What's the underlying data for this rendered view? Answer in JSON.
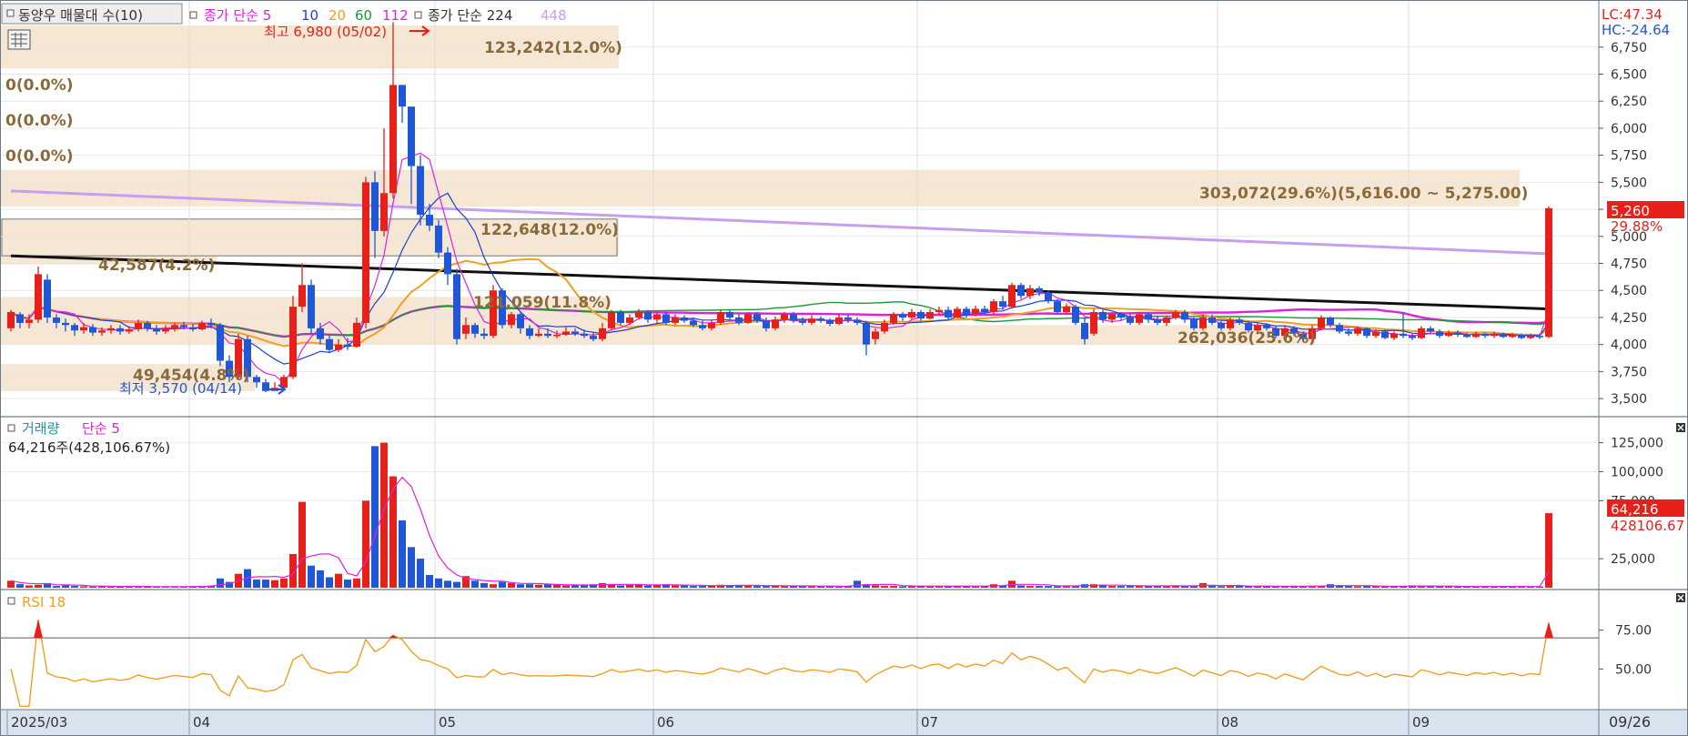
{
  "legend": {
    "profile_label": "동양우 매물대 수(10)",
    "ma_label": "종가 단순 5",
    "ma_periods": [
      {
        "label": "10",
        "color": "#1f3fd0"
      },
      {
        "label": "20",
        "color": "#f0a020"
      },
      {
        "label": "60",
        "color": "#1a9a3a"
      },
      {
        "label": "112",
        "color": "#e020e0"
      }
    ],
    "long_ma_label": "종가 단순 224",
    "long_ma_period": "448"
  },
  "price_panel": {
    "y_ticks": [
      "6,750",
      "6,500",
      "6,250",
      "6,000",
      "5,750",
      "5,500",
      "5,250",
      "5,000",
      "4,750",
      "4,500",
      "4,250",
      "4,000",
      "3,750",
      "3,500"
    ],
    "lc_label": "LC:47.34",
    "hc_label": "HC:-24.64",
    "last_price": "5,260",
    "last_change": "29.88%",
    "high_marker": "최고 6,980 (05/02)",
    "low_marker": "최저 3,570 (04/14)",
    "profile_labels": [
      "0(0.0%)",
      "0(0.0%)",
      "0(0.0%)",
      "123,242(12.0%)",
      "303,072(29.6%)(5,616.00 ~ 5,275.00)",
      "122,648(12.0%)",
      "42,587(4.2%)",
      "121,059(11.8%)",
      "262,036(25.6%)",
      "49,454(4.8%)"
    ]
  },
  "volume_panel": {
    "title": "거래량",
    "ma_label": "단순 5",
    "info": "64,216주(428,106.67%)",
    "y_ticks": [
      "125,000",
      "100,000",
      "75,000",
      "25,000"
    ],
    "last_volume": "64,216",
    "last_ma": "428106.67"
  },
  "rsi_panel": {
    "title": "RSI 18",
    "y_ticks": [
      "75.00",
      "50.00"
    ]
  },
  "x_axis": {
    "labels": [
      "2025/03",
      "04",
      "05",
      "06",
      "07",
      "08",
      "09"
    ],
    "last_date": "09/26"
  },
  "colors": {
    "up": "#e8201a",
    "down": "#1f57d6",
    "rsi": "#f0a020",
    "zone": "#f5e7d3"
  },
  "chart_data": {
    "type": "candlestick",
    "price_range": [
      3400,
      6950
    ],
    "volume_range": [
      0,
      138000
    ],
    "rsi_range": [
      25,
      100
    ],
    "months": [
      "2025/03",
      "04",
      "05",
      "06",
      "07",
      "08",
      "09"
    ],
    "candles": [
      [
        4150,
        4300,
        4320,
        4120
      ],
      [
        4280,
        4200,
        4300,
        4150
      ],
      [
        4200,
        4230,
        4280,
        4150
      ],
      [
        4230,
        4650,
        4720,
        4200
      ],
      [
        4600,
        4250,
        4650,
        4200
      ],
      [
        4250,
        4200,
        4280,
        4150
      ],
      [
        4200,
        4180,
        4240,
        4120
      ],
      [
        4180,
        4130,
        4200,
        4080
      ],
      [
        4130,
        4160,
        4200,
        4100
      ],
      [
        4160,
        4110,
        4190,
        4080
      ],
      [
        4110,
        4130,
        4160,
        4080
      ],
      [
        4130,
        4150,
        4180,
        4100
      ],
      [
        4150,
        4120,
        4180,
        4090
      ],
      [
        4120,
        4140,
        4170,
        4100
      ],
      [
        4140,
        4200,
        4230,
        4120
      ],
      [
        4200,
        4150,
        4220,
        4120
      ],
      [
        4150,
        4120,
        4180,
        4090
      ],
      [
        4120,
        4150,
        4180,
        4100
      ],
      [
        4150,
        4180,
        4200,
        4120
      ],
      [
        4180,
        4160,
        4210,
        4140
      ],
      [
        4160,
        4140,
        4190,
        4120
      ],
      [
        4140,
        4200,
        4220,
        4130
      ],
      [
        4200,
        4180,
        4240,
        4150
      ],
      [
        4180,
        3850,
        4200,
        3800
      ],
      [
        3850,
        3700,
        3900,
        3650
      ],
      [
        3700,
        4050,
        4100,
        3680
      ],
      [
        4050,
        3700,
        4080,
        3650
      ],
      [
        3700,
        3650,
        3720,
        3600
      ],
      [
        3650,
        3570,
        3680,
        3560
      ],
      [
        3570,
        3600,
        3650,
        3570
      ],
      [
        3600,
        3700,
        3720,
        3580
      ],
      [
        3700,
        4350,
        4450,
        3680
      ],
      [
        4350,
        4550,
        4750,
        4300
      ],
      [
        4550,
        4150,
        4600,
        4100
      ],
      [
        4150,
        4050,
        4200,
        4000
      ],
      [
        4050,
        3950,
        4100,
        3920
      ],
      [
        3950,
        4000,
        4050,
        3930
      ],
      [
        4000,
        3980,
        4060,
        3950
      ],
      [
        3980,
        4200,
        4250,
        3970
      ],
      [
        4200,
        5500,
        5550,
        4150
      ],
      [
        5500,
        5050,
        5600,
        4800
      ],
      [
        5050,
        5400,
        6000,
        5000
      ],
      [
        5400,
        6400,
        6980,
        5350
      ],
      [
        6400,
        6200,
        6400,
        6050
      ],
      [
        6200,
        5650,
        6200,
        5300
      ],
      [
        5650,
        5200,
        5750,
        5100
      ],
      [
        5200,
        5100,
        5300,
        5050
      ],
      [
        5100,
        4850,
        5150,
        4800
      ],
      [
        4850,
        4650,
        4900,
        4550
      ],
      [
        4650,
        4050,
        4700,
        4000
      ],
      [
        4100,
        4180,
        4250,
        4050
      ],
      [
        4180,
        4100,
        4200,
        4060
      ],
      [
        4100,
        4080,
        4150,
        4050
      ],
      [
        4080,
        4500,
        4550,
        4060
      ],
      [
        4500,
        4180,
        4520,
        4150
      ],
      [
        4180,
        4280,
        4300,
        4150
      ],
      [
        4280,
        4150,
        4300,
        4100
      ],
      [
        4150,
        4080,
        4180,
        4050
      ],
      [
        4080,
        4100,
        4150,
        4070
      ],
      [
        4100,
        4080,
        4150,
        4060
      ],
      [
        4080,
        4090,
        4130,
        4060
      ],
      [
        4090,
        4120,
        4160,
        4080
      ],
      [
        4120,
        4100,
        4150,
        4080
      ],
      [
        4100,
        4080,
        4140,
        4060
      ],
      [
        4080,
        4050,
        4110,
        4030
      ],
      [
        4050,
        4150,
        4200,
        4030
      ],
      [
        4150,
        4300,
        4320,
        4140
      ],
      [
        4300,
        4200,
        4320,
        4180
      ],
      [
        4200,
        4250,
        4280,
        4180
      ],
      [
        4250,
        4300,
        4330,
        4230
      ],
      [
        4300,
        4230,
        4320,
        4200
      ],
      [
        4230,
        4280,
        4300,
        4200
      ],
      [
        4280,
        4200,
        4300,
        4180
      ],
      [
        4200,
        4250,
        4280,
        4180
      ],
      [
        4250,
        4220,
        4270,
        4200
      ],
      [
        4220,
        4180,
        4250,
        4160
      ],
      [
        4180,
        4150,
        4220,
        4130
      ],
      [
        4150,
        4200,
        4230,
        4130
      ],
      [
        4200,
        4300,
        4320,
        4180
      ],
      [
        4300,
        4250,
        4320,
        4220
      ],
      [
        4250,
        4200,
        4280,
        4180
      ],
      [
        4200,
        4280,
        4300,
        4190
      ],
      [
        4280,
        4220,
        4300,
        4200
      ],
      [
        4220,
        4150,
        4250,
        4120
      ],
      [
        4150,
        4230,
        4260,
        4130
      ],
      [
        4230,
        4280,
        4300,
        4200
      ],
      [
        4280,
        4220,
        4300,
        4200
      ],
      [
        4220,
        4200,
        4250,
        4180
      ],
      [
        4200,
        4240,
        4270,
        4180
      ],
      [
        4240,
        4220,
        4260,
        4200
      ],
      [
        4220,
        4190,
        4240,
        4170
      ],
      [
        4190,
        4250,
        4280,
        4180
      ],
      [
        4250,
        4230,
        4280,
        4200
      ],
      [
        4230,
        4200,
        4250,
        4180
      ],
      [
        4200,
        4000,
        4220,
        3900
      ],
      [
        4050,
        4120,
        4150,
        4000
      ],
      [
        4120,
        4200,
        4230,
        4100
      ],
      [
        4200,
        4280,
        4300,
        4180
      ],
      [
        4280,
        4250,
        4300,
        4220
      ],
      [
        4250,
        4300,
        4330,
        4230
      ],
      [
        4300,
        4240,
        4320,
        4220
      ],
      [
        4240,
        4300,
        4330,
        4230
      ],
      [
        4300,
        4320,
        4350,
        4270
      ],
      [
        4320,
        4250,
        4350,
        4230
      ],
      [
        4250,
        4330,
        4350,
        4240
      ],
      [
        4330,
        4280,
        4350,
        4250
      ],
      [
        4280,
        4330,
        4360,
        4260
      ],
      [
        4330,
        4300,
        4360,
        4280
      ],
      [
        4300,
        4400,
        4420,
        4280
      ],
      [
        4400,
        4350,
        4450,
        4320
      ],
      [
        4350,
        4550,
        4570,
        4330
      ],
      [
        4550,
        4450,
        4570,
        4420
      ],
      [
        4450,
        4520,
        4550,
        4420
      ],
      [
        4520,
        4480,
        4540,
        4450
      ],
      [
        4480,
        4400,
        4500,
        4380
      ],
      [
        4400,
        4300,
        4420,
        4280
      ],
      [
        4300,
        4350,
        4380,
        4280
      ],
      [
        4350,
        4200,
        4370,
        4180
      ],
      [
        4200,
        4050,
        4250,
        4000
      ],
      [
        4100,
        4300,
        4330,
        4080
      ],
      [
        4300,
        4230,
        4320,
        4200
      ],
      [
        4230,
        4280,
        4300,
        4200
      ],
      [
        4280,
        4250,
        4300,
        4220
      ],
      [
        4250,
        4200,
        4280,
        4180
      ],
      [
        4200,
        4280,
        4300,
        4180
      ],
      [
        4280,
        4230,
        4300,
        4200
      ],
      [
        4230,
        4200,
        4260,
        4180
      ],
      [
        4200,
        4250,
        4270,
        4170
      ],
      [
        4250,
        4300,
        4320,
        4230
      ],
      [
        4300,
        4230,
        4320,
        4200
      ],
      [
        4230,
        4150,
        4250,
        4130
      ],
      [
        4150,
        4250,
        4280,
        4130
      ],
      [
        4250,
        4200,
        4280,
        4180
      ],
      [
        4200,
        4150,
        4220,
        4130
      ],
      [
        4150,
        4230,
        4250,
        4130
      ],
      [
        4230,
        4200,
        4250,
        4180
      ],
      [
        4200,
        4130,
        4220,
        4110
      ],
      [
        4130,
        4180,
        4200,
        4110
      ],
      [
        4180,
        4150,
        4200,
        4130
      ],
      [
        4150,
        4080,
        4170,
        4060
      ],
      [
        4080,
        4150,
        4180,
        4060
      ],
      [
        4150,
        4100,
        4170,
        4080
      ],
      [
        4100,
        4050,
        4120,
        4030
      ],
      [
        4050,
        4150,
        4180,
        4040
      ],
      [
        4150,
        4250,
        4270,
        4130
      ],
      [
        4250,
        4180,
        4260,
        4160
      ],
      [
        4180,
        4120,
        4200,
        4100
      ],
      [
        4120,
        4100,
        4150,
        4080
      ],
      [
        4100,
        4150,
        4170,
        4080
      ],
      [
        4150,
        4080,
        4160,
        4060
      ],
      [
        4080,
        4120,
        4140,
        4060
      ],
      [
        4120,
        4060,
        4140,
        4050
      ],
      [
        4060,
        4100,
        4120,
        4040
      ],
      [
        4100,
        4080,
        4300,
        4060
      ],
      [
        4080,
        4060,
        4100,
        4040
      ],
      [
        4060,
        4150,
        4170,
        4050
      ],
      [
        4150,
        4120,
        4170,
        4100
      ],
      [
        4120,
        4080,
        4140,
        4060
      ],
      [
        4080,
        4110,
        4130,
        4070
      ],
      [
        4110,
        4090,
        4130,
        4070
      ],
      [
        4090,
        4070,
        4110,
        4060
      ],
      [
        4070,
        4100,
        4120,
        4060
      ],
      [
        4100,
        4080,
        4110,
        4060
      ],
      [
        4080,
        4100,
        4120,
        4060
      ],
      [
        4100,
        4070,
        4110,
        4060
      ],
      [
        4070,
        4090,
        4110,
        4060
      ],
      [
        4090,
        4060,
        4100,
        4050
      ],
      [
        4060,
        4080,
        4100,
        4050
      ],
      [
        4080,
        4070,
        4100,
        4050
      ],
      [
        4070,
        5260,
        5280,
        4060
      ]
    ],
    "volumes": [
      6000,
      3000,
      2000,
      2500,
      4000,
      1500,
      2000,
      1500,
      1200,
      1000,
      1200,
      1500,
      1000,
      1200,
      1000,
      800,
      900,
      1000,
      1200,
      1000,
      1000,
      1500,
      1800,
      8000,
      5000,
      12000,
      16000,
      7000,
      7000,
      6500,
      8000,
      29000,
      74000,
      19000,
      15000,
      9000,
      12000,
      7000,
      8000,
      75000,
      122000,
      125000,
      96000,
      58000,
      35000,
      25000,
      11000,
      8000,
      6000,
      5000,
      10000,
      6000,
      4000,
      3000,
      5000,
      4000,
      3000,
      3000,
      2500,
      3000,
      2500,
      2000,
      2200,
      2000,
      3000,
      4000,
      3000,
      2000,
      2500,
      3000,
      2000,
      2500,
      3000,
      2000,
      2000,
      1500,
      1500,
      2000,
      2500,
      2000,
      2000,
      2000,
      1500,
      1500,
      2000,
      1500,
      1500,
      1500,
      1200,
      1500,
      1200,
      1000,
      1500,
      6000,
      3000,
      2000,
      1500,
      1500,
      1200,
      1500,
      1200,
      1500,
      1500,
      1500,
      1200,
      1200,
      1500,
      1500,
      3000,
      2000,
      6000,
      2000,
      1500,
      1500,
      1500,
      1200,
      2000,
      1500,
      3000,
      3000,
      2000,
      1500,
      1500,
      1500,
      2000,
      1200,
      1500,
      1500,
      2000,
      1500,
      1200,
      4000,
      1500,
      1200,
      1500,
      1500,
      1200,
      1500,
      1200,
      1200,
      1500,
      1200,
      1500,
      1500,
      1200,
      3000,
      2000,
      1500,
      1200,
      1500,
      1200,
      1200,
      1500,
      1200,
      2000,
      1500,
      1200,
      1200,
      1200,
      1000,
      1000,
      1200,
      1200,
      1000,
      1000,
      1200,
      1000,
      1000,
      1000,
      64216
    ],
    "ma224": [
      [
        0,
        4820
      ],
      [
        1438,
        4330
      ]
    ],
    "ma448": [
      [
        0,
        5420
      ],
      [
        1438,
        4840
      ]
    ]
  }
}
